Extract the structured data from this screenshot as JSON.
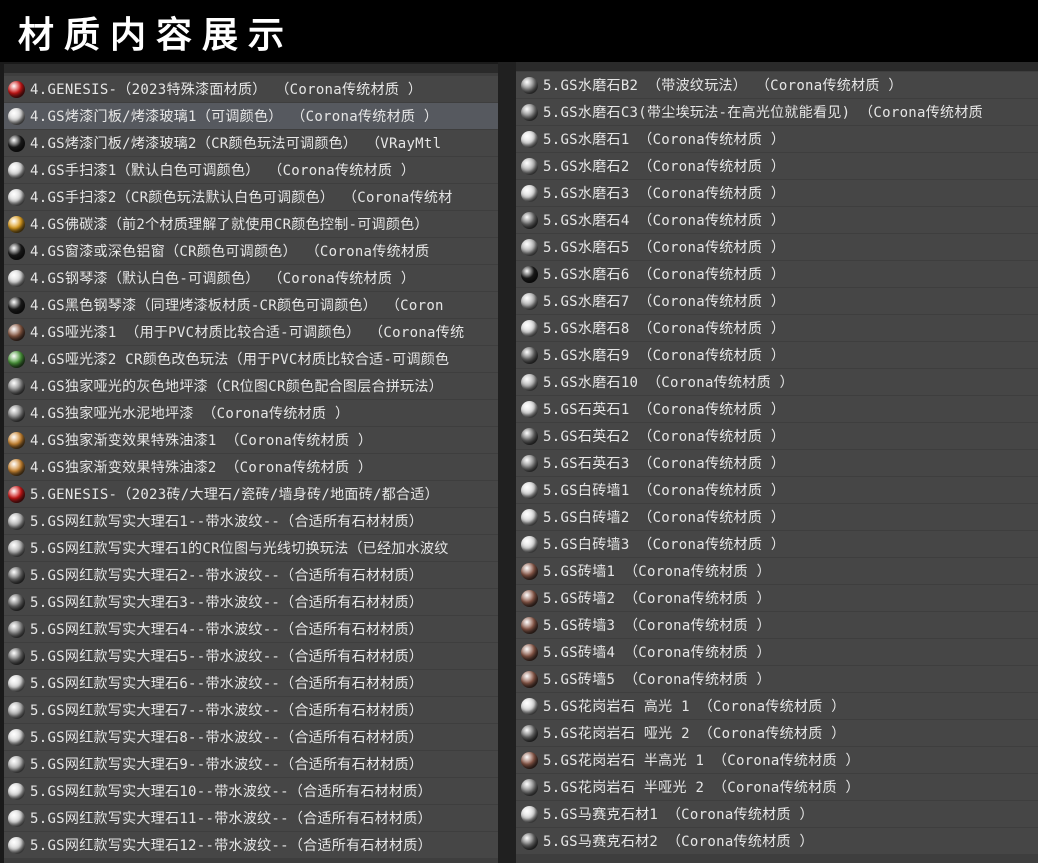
{
  "header": {
    "title": "材质内容展示"
  },
  "colors": {
    "red": "#d01818",
    "white": "#dcdcdc",
    "black": "#1c1c1c",
    "gold": "#e0a020",
    "brown": "#8a5a44",
    "green": "#4c9a3c",
    "gray": "#8a8a8a",
    "orange": "#d08a34",
    "marble": "#b8b8b8",
    "stone": "#6a6a6a",
    "brick": "#8c5a4a"
  },
  "left_list": [
    {
      "label": "4.GENESIS-（2023特殊漆面材质）  （Corona传统材质 ）",
      "ball": "red"
    },
    {
      "label": "4.GS烤漆门板/烤漆玻璃1（可调颜色）   （Corona传统材质 ）",
      "ball": "white"
    },
    {
      "label": "4.GS烤漆门板/烤漆玻璃2（CR颜色玩法可调颜色）   （VRayMtl",
      "ball": "black"
    },
    {
      "label": "4.GS手扫漆1（默认白色可调颜色）   （Corona传统材质 ）",
      "ball": "white"
    },
    {
      "label": "4.GS手扫漆2（CR颜色玩法默认白色可调颜色）   （Corona传统材",
      "ball": "white"
    },
    {
      "label": "4.GS佛碳漆（前2个材质理解了就使用CR颜色控制-可调颜色）",
      "ball": "gold"
    },
    {
      "label": "4.GS窗漆或深色铝窗（CR颜色可调颜色）   （Corona传统材质",
      "ball": "black"
    },
    {
      "label": "4.GS钢琴漆（默认白色-可调颜色）   （Corona传统材质 ）",
      "ball": "white"
    },
    {
      "label": "4.GS黑色钢琴漆（同理烤漆板材质-CR颜色可调颜色）   （Coron",
      "ball": "black"
    },
    {
      "label": "4.GS哑光漆1 （用于PVC材质比较合适-可调颜色）  （Corona传统",
      "ball": "brown"
    },
    {
      "label": "4.GS哑光漆2  CR颜色改色玩法（用于PVC材质比较合适-可调颜色",
      "ball": "green"
    },
    {
      "label": "4.GS独家哑光的灰色地坪漆（CR位图CR颜色配合图层合拼玩法）",
      "ball": "gray"
    },
    {
      "label": "4.GS独家哑光水泥地坪漆   （Corona传统材质 ）",
      "ball": "gray"
    },
    {
      "label": "4.GS独家渐变效果特殊油漆1   （Corona传统材质 ）",
      "ball": "orange"
    },
    {
      "label": "4.GS独家渐变效果特殊油漆2   （Corona传统材质 ）",
      "ball": "orange"
    },
    {
      "label": "5.GENESIS-（2023砖/大理石/瓷砖/墙身砖/地面砖/都合适）",
      "ball": "red"
    },
    {
      "label": "5.GS网红款写实大理石1--带水波纹--（合适所有石材材质）",
      "ball": "marble"
    },
    {
      "label": "5.GS网红款写实大理石1的CR位图与光线切换玩法（已经加水波纹",
      "ball": "marble"
    },
    {
      "label": "5.GS网红款写实大理石2--带水波纹--（合适所有石材材质）",
      "ball": "stone"
    },
    {
      "label": "5.GS网红款写实大理石3--带水波纹--（合适所有石材材质）",
      "ball": "stone"
    },
    {
      "label": "5.GS网红款写实大理石4--带水波纹--（合适所有石材材质）",
      "ball": "gray"
    },
    {
      "label": "5.GS网红款写实大理石5--带水波纹--（合适所有石材材质）",
      "ball": "stone"
    },
    {
      "label": "5.GS网红款写实大理石6--带水波纹--（合适所有石材材质）",
      "ball": "white"
    },
    {
      "label": "5.GS网红款写实大理石7--带水波纹--（合适所有石材材质）",
      "ball": "marble"
    },
    {
      "label": "5.GS网红款写实大理石8--带水波纹--（合适所有石材材质）",
      "ball": "white"
    },
    {
      "label": "5.GS网红款写实大理石9--带水波纹--（合适所有石材材质）",
      "ball": "marble"
    },
    {
      "label": "5.GS网红款写实大理石10--带水波纹--（合适所有石材材质）",
      "ball": "white"
    },
    {
      "label": "5.GS网红款写实大理石11--带水波纹--（合适所有石材材质）",
      "ball": "white"
    },
    {
      "label": "5.GS网红款写实大理石12--带水波纹--（合适所有石材材质）",
      "ball": "white"
    }
  ],
  "right_list": [
    {
      "label": "5.GS水磨石B2 （带波纹玩法）  （Corona传统材质 ）",
      "ball": "gray"
    },
    {
      "label": "5.GS水磨石C3(带尘埃玩法-在高光位就能看见)   （Corona传统材质",
      "ball": "gray"
    },
    {
      "label": "5.GS水磨石1  （Corona传统材质 ）",
      "ball": "white"
    },
    {
      "label": "5.GS水磨石2  （Corona传统材质 ）",
      "ball": "marble"
    },
    {
      "label": "5.GS水磨石3  （Corona传统材质 ）",
      "ball": "white"
    },
    {
      "label": "5.GS水磨石4  （Corona传统材质 ）",
      "ball": "stone"
    },
    {
      "label": "5.GS水磨石5  （Corona传统材质 ）",
      "ball": "marble"
    },
    {
      "label": "5.GS水磨石6  （Corona传统材质 ）",
      "ball": "black"
    },
    {
      "label": "5.GS水磨石7  （Corona传统材质 ）",
      "ball": "marble"
    },
    {
      "label": "5.GS水磨石8  （Corona传统材质 ）",
      "ball": "white"
    },
    {
      "label": "5.GS水磨石9  （Corona传统材质 ）",
      "ball": "stone"
    },
    {
      "label": "5.GS水磨石10  （Corona传统材质 ）",
      "ball": "marble"
    },
    {
      "label": "5.GS石英石1  （Corona传统材质 ）",
      "ball": "white"
    },
    {
      "label": "5.GS石英石2  （Corona传统材质 ）",
      "ball": "stone"
    },
    {
      "label": "5.GS石英石3  （Corona传统材质 ）",
      "ball": "gray"
    },
    {
      "label": "5.GS白砖墙1  （Corona传统材质 ）",
      "ball": "white"
    },
    {
      "label": "5.GS白砖墙2  （Corona传统材质 ）",
      "ball": "white"
    },
    {
      "label": "5.GS白砖墙3  （Corona传统材质 ）",
      "ball": "white"
    },
    {
      "label": "5.GS砖墙1  （Corona传统材质 ）",
      "ball": "brick"
    },
    {
      "label": "5.GS砖墙2  （Corona传统材质 ）",
      "ball": "brick"
    },
    {
      "label": "5.GS砖墙3  （Corona传统材质 ）",
      "ball": "brick"
    },
    {
      "label": "5.GS砖墙4  （Corona传统材质 ）",
      "ball": "brick"
    },
    {
      "label": "5.GS砖墙5  （Corona传统材质 ）",
      "ball": "brick"
    },
    {
      "label": "5.GS花岗岩石 高光 1  （Corona传统材质 ）",
      "ball": "white"
    },
    {
      "label": "5.GS花岗岩石 哑光 2  （Corona传统材质 ）",
      "ball": "stone"
    },
    {
      "label": "5.GS花岗岩石 半高光 1  （Corona传统材质 ）",
      "ball": "brick"
    },
    {
      "label": "5.GS花岗岩石 半哑光 2  （Corona传统材质 ）",
      "ball": "gray"
    },
    {
      "label": "5.GS马赛克石材1  （Corona传统材质 ）",
      "ball": "white"
    },
    {
      "label": "5.GS马赛克石材2  （Corona传统材质 ）",
      "ball": "stone"
    }
  ]
}
